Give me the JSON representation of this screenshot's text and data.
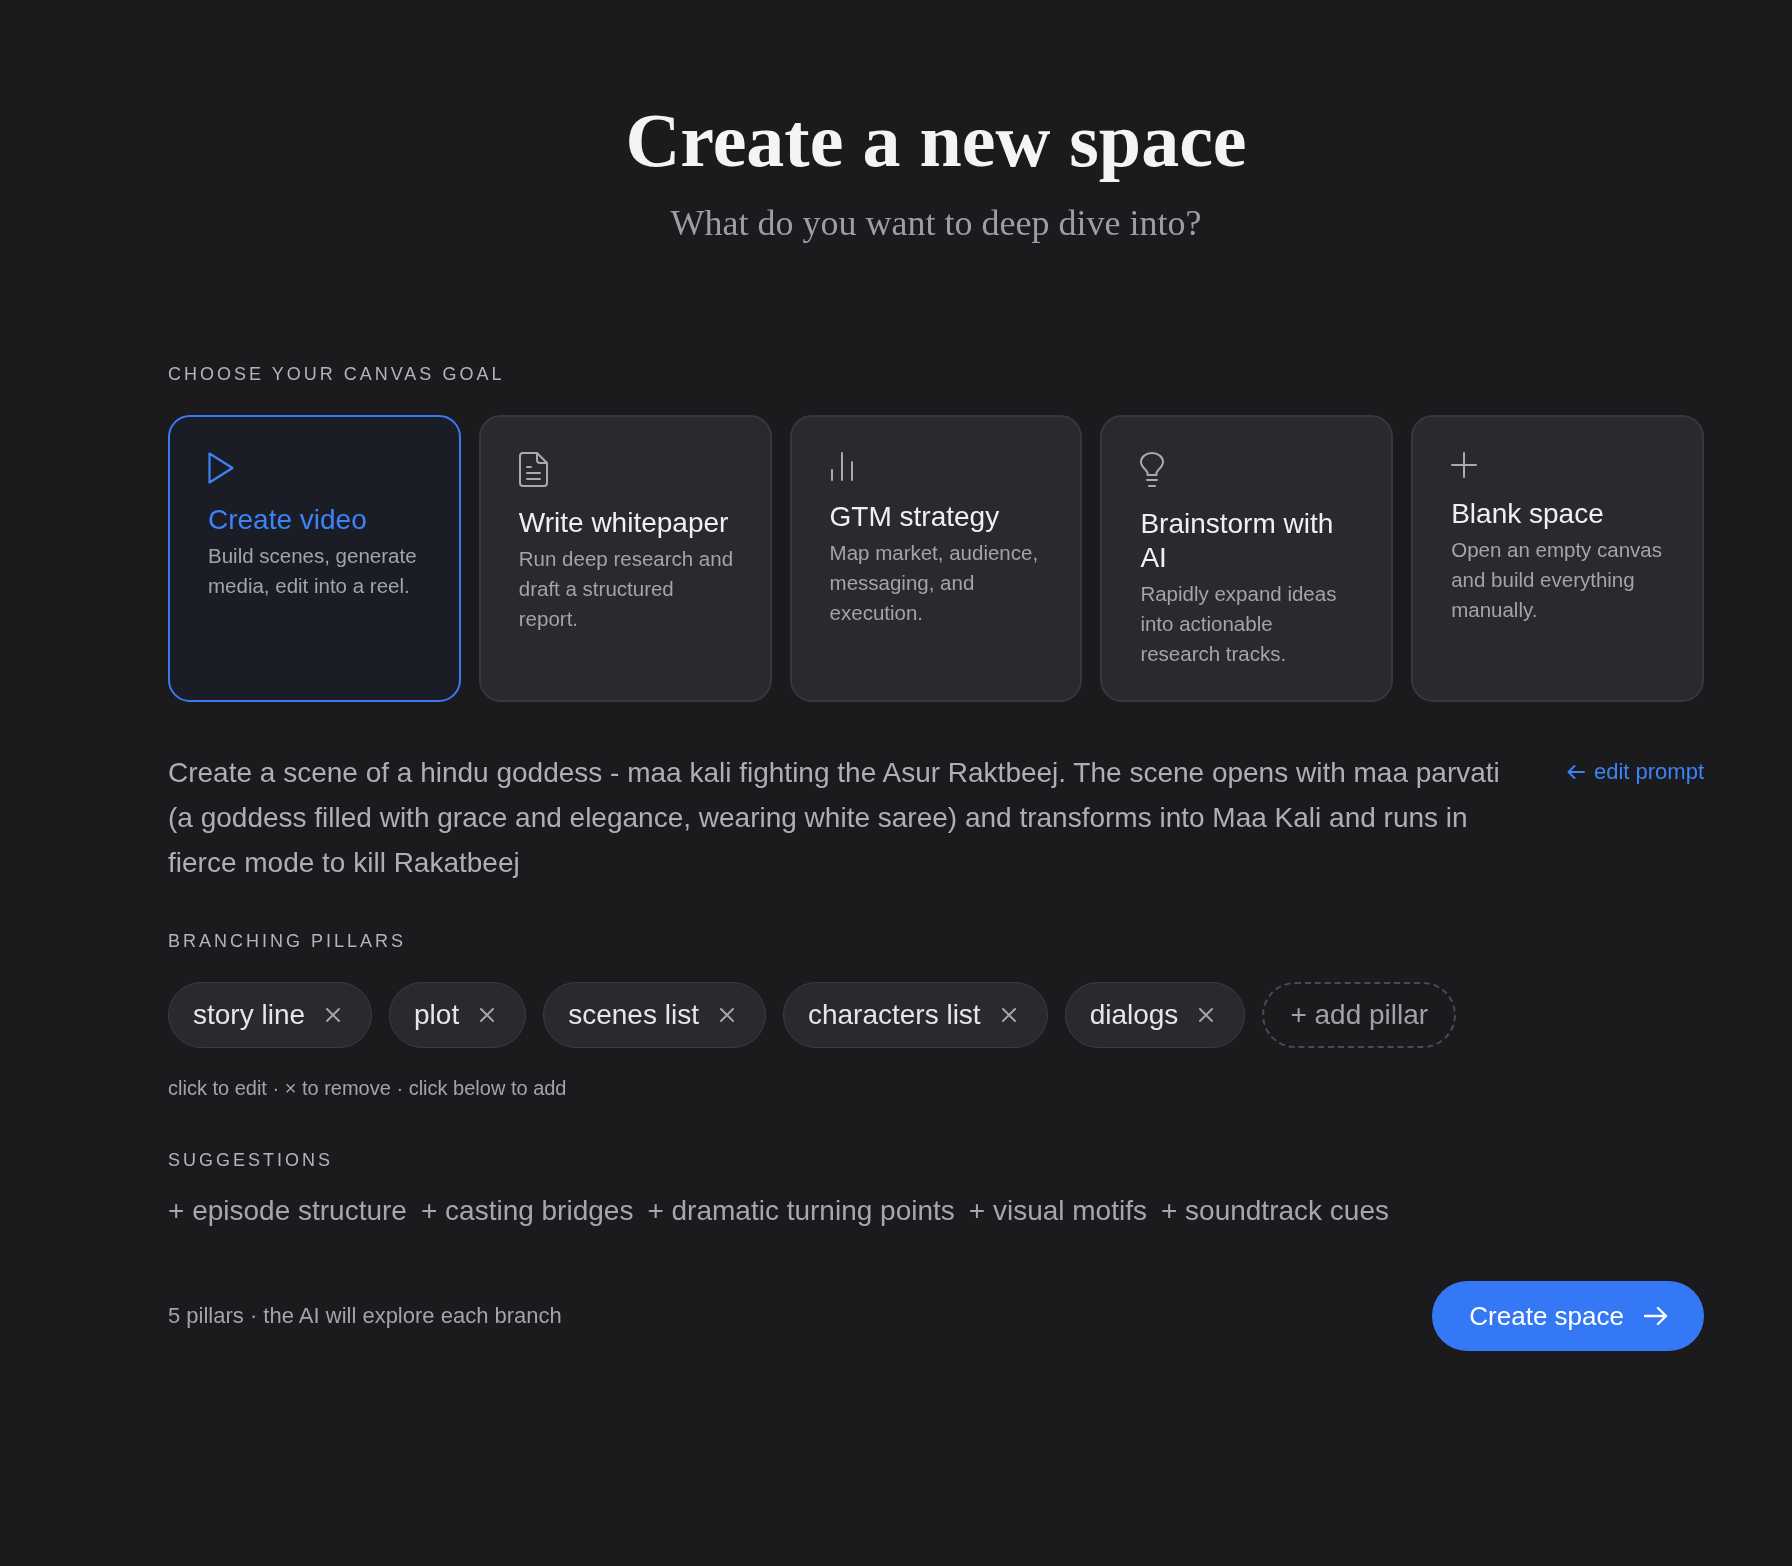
{
  "header": {
    "title": "Create a new space",
    "subtitle": "What do you want to deep dive into?"
  },
  "goal_section": {
    "heading": "CHOOSE YOUR CANVAS GOAL",
    "cards": [
      {
        "kind": "play",
        "title": "Create video",
        "description": "Build scenes, generate media, edit into a reel.",
        "selected": true
      },
      {
        "kind": "document",
        "title": "Write whitepaper",
        "description": "Run deep research and draft a structured report.",
        "selected": false
      },
      {
        "kind": "chart",
        "title": "GTM strategy",
        "description": "Map market, audience, messaging, and execution.",
        "selected": false
      },
      {
        "kind": "idea",
        "title": "Brainstorm with AI",
        "description": "Rapidly expand ideas into actionable research tracks.",
        "selected": false
      },
      {
        "kind": "blank",
        "title": "Blank space",
        "description": "Open an empty canvas and build everything manually.",
        "selected": false
      }
    ]
  },
  "prompt": {
    "text": "Create a scene of a hindu goddess - maa kali fighting the Asur Raktbeej. The scene opens with maa parvati (a goddess filled with grace and elegance, wearing white saree) and transforms into Maa Kali and runs in fierce mode to kill Rakatbeej",
    "edit_link": "edit prompt"
  },
  "pillars_section": {
    "heading": "BRANCHING PILLARS",
    "pillars": [
      "story line",
      "plot",
      "scenes list",
      "characters list",
      "dialogs"
    ],
    "add_button": "+ add pillar",
    "hint": "click to edit · × to remove · click below to add"
  },
  "suggestions_section": {
    "heading": "SUGGESTIONS",
    "items": [
      "+ episode structure",
      "+ casting bridges",
      "+ dramatic turning points",
      "+ visual motifs",
      "+ soundtrack cues"
    ]
  },
  "footer": {
    "summary": "5 pillars · the AI will explore each branch",
    "create_button": "Create space"
  }
}
